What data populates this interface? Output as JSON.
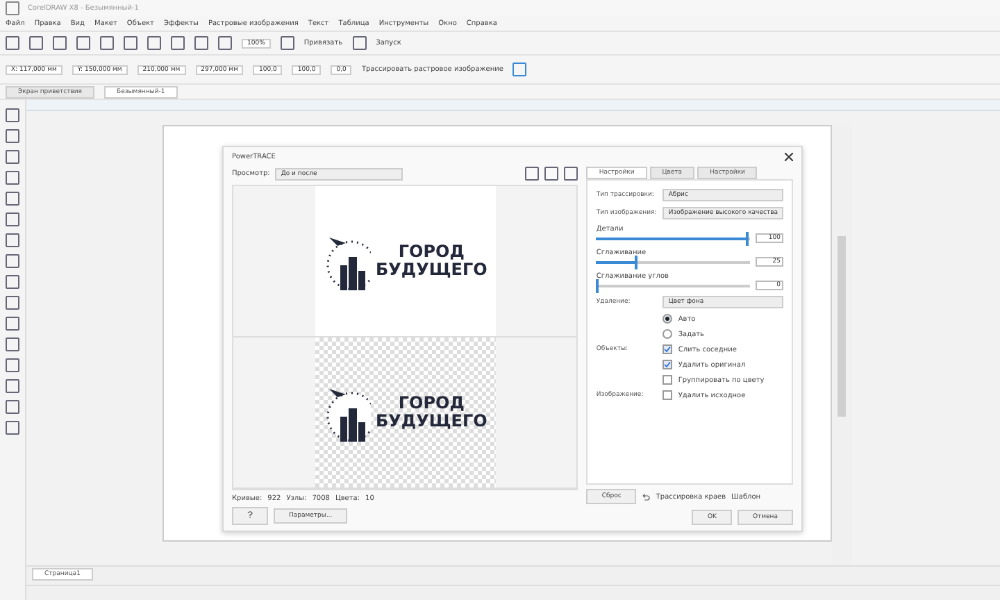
{
  "window": {
    "title": "CorelDRAW X8 - Безымянный-1"
  },
  "menu": [
    "Файл",
    "Правка",
    "Вид",
    "Макет",
    "Объект",
    "Эффекты",
    "Растровые изображения",
    "Текст",
    "Таблица",
    "Инструменты",
    "Окно",
    "Справка"
  ],
  "toolbar": {
    "zoom": "100%",
    "snap": "Привязать",
    "launch": "Запуск"
  },
  "property_bar": {
    "x": "X: 117,000 мм",
    "y": "Y: 150,000 мм",
    "w": "210,000 мм",
    "h": "297,000 мм",
    "sx": "100,0",
    "sy": "100,0",
    "angle": "0,0",
    "trace": "Трассировать растровое изображение"
  },
  "doc_tabs": [
    {
      "label": "Экран приветствия",
      "selected": false
    },
    {
      "label": "Безымянный-1",
      "selected": true
    }
  ],
  "dialog": {
    "title": "PowerTRACE",
    "preview_label": "Просмотр:",
    "preview_value": "До и после",
    "previews": [
      {
        "kind": "original",
        "logo_lines": [
          "ГОРОД",
          "БУДУЩЕГО"
        ]
      },
      {
        "kind": "traced",
        "logo_lines": [
          "ГОРОД",
          "БУДУЩЕГО"
        ]
      }
    ],
    "tabs": [
      {
        "label": "Настройки",
        "selected": true
      },
      {
        "label": "Цвета",
        "selected": false
      },
      {
        "label": "Настройки",
        "selected": false
      }
    ],
    "selects": [
      {
        "label": "Тип трассировки:",
        "value": "Абрис"
      },
      {
        "label": "Тип изображения:",
        "value": "Изображение высокого качества"
      }
    ],
    "sliders": [
      {
        "label": "Детали",
        "level": 0.97,
        "reading": "100"
      },
      {
        "label": "Сглаживание",
        "level": 0.25,
        "reading": "25"
      },
      {
        "label": "Сглаживание углов",
        "level": 0.0,
        "reading": "0"
      }
    ],
    "remove": {
      "label": "Удаление:",
      "value": "Цвет фона",
      "options": [
        {
          "label": "Авто",
          "selected": true
        },
        {
          "label": "Задать",
          "selected": false
        }
      ]
    },
    "objects_label": "Объекты:",
    "objects": [
      {
        "label": "Слить соседние",
        "checked": true
      },
      {
        "label": "Удалить оригинал",
        "checked": true
      },
      {
        "label": "Группировать по цвету",
        "checked": false
      }
    ],
    "image_label": "Изображение:",
    "image": [
      {
        "label": "Удалить исходное",
        "checked": false
      }
    ],
    "stats": [
      "Кривые:",
      "922",
      "Узлы:",
      "7008",
      "Цвета:",
      "10"
    ],
    "reset": "Сброс",
    "edge_trace": "Трассировка краев",
    "edge_value": "Шаблон",
    "options": "Параметры...",
    "ok": "OK",
    "cancel": "Отмена"
  },
  "page_tabs": [
    "Страница1"
  ]
}
